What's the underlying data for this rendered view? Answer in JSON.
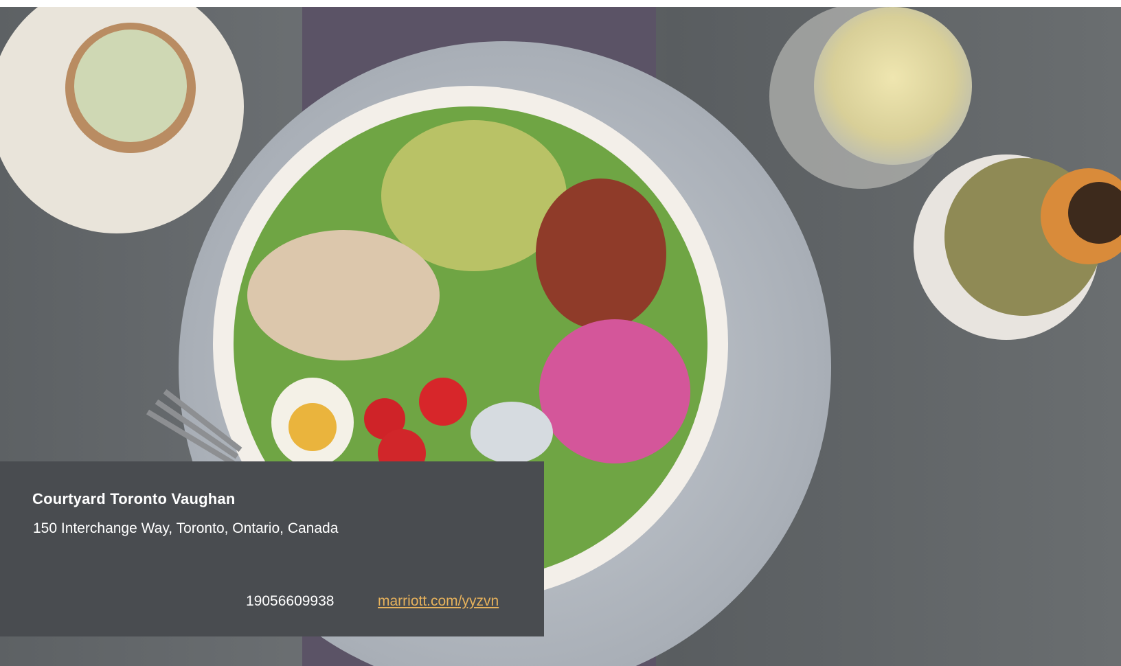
{
  "hero": {
    "image_icon": "cobb-salad-photo"
  },
  "hotel": {
    "name": "Courtyard Toronto Vaughan",
    "address": "150 Interchange Way, Toronto, Ontario, Canada",
    "phone": "19056609938",
    "website": "marriott.com/yyzvn"
  },
  "colors": {
    "card_bg": "#494c50",
    "link": "#e7b25c"
  }
}
